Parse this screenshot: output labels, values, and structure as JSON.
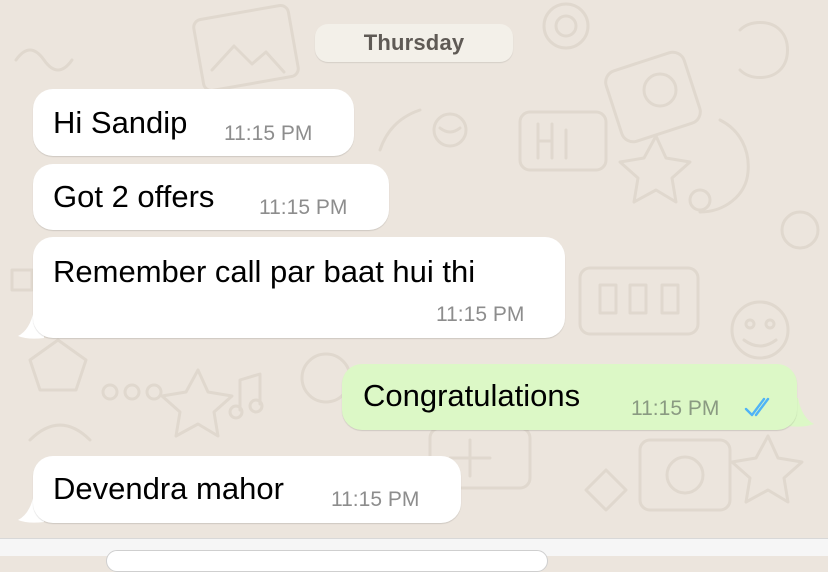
{
  "chat": {
    "day_label": "Thursday",
    "messages": [
      {
        "direction": "incoming",
        "text": "Hi Sandip",
        "time": "11:15 PM"
      },
      {
        "direction": "incoming",
        "text": "Got 2 offers",
        "time": "11:15 PM"
      },
      {
        "direction": "incoming",
        "text": "Remember call par baat hui thi",
        "time": "11:15 PM"
      },
      {
        "direction": "outgoing",
        "text": "Congratulations",
        "time": "11:15 PM",
        "status": "read"
      },
      {
        "direction": "incoming",
        "text": "Devendra mahor",
        "time": "11:15 PM"
      }
    ]
  },
  "colors": {
    "wallpaper": "#ece5dd",
    "incoming_bubble": "#ffffff",
    "outgoing_bubble": "#dcf8c6",
    "read_ticks": "#4fb3f6",
    "timestamp": "#8d8d8d"
  },
  "icons": {
    "read_status": "double-check-icon"
  }
}
